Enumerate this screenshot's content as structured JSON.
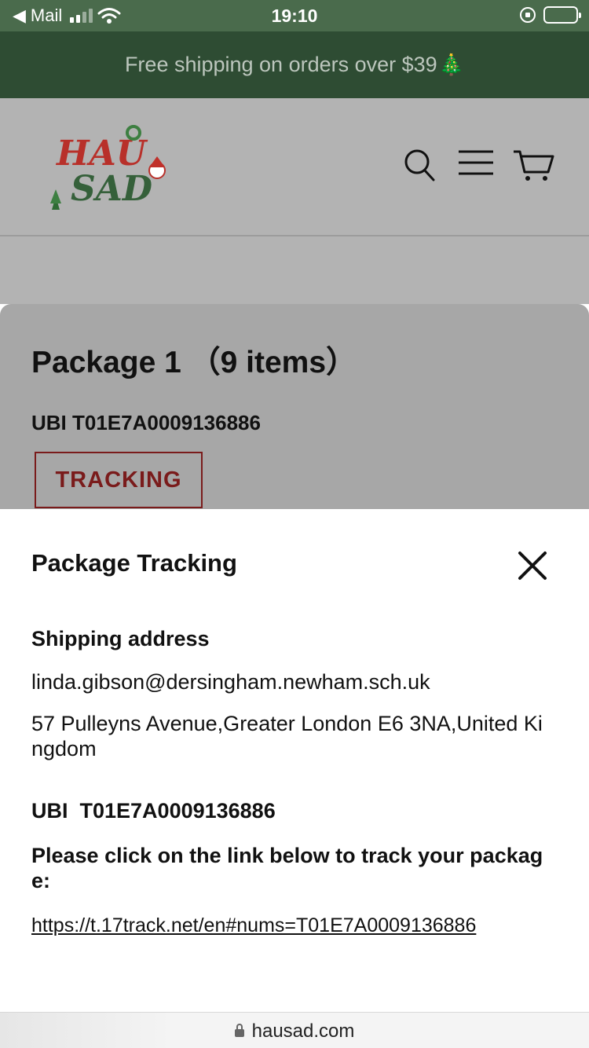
{
  "status_bar": {
    "back_app": "Mail",
    "time": "19:10"
  },
  "announcement": {
    "text": "Free shipping on orders over $39",
    "emoji": "🎄"
  },
  "header": {
    "logo_alt": "HAU SAD",
    "logo_line1": "HAU",
    "logo_line2": "SAD",
    "icons": [
      "search-icon",
      "menu-icon",
      "cart-icon"
    ]
  },
  "package": {
    "title": "Package 1 （9 items）",
    "ubi": "UBI T01E7A0009136886",
    "tracking_label": "TRACKING"
  },
  "tracking_sheet": {
    "title": "Package Tracking",
    "shipping_heading": "Shipping address",
    "email": "linda.gibson@dersingham.newham.sch.uk",
    "address": "57 Pulleyns Avenue,Greater London E6 3NA,United Kingdom",
    "ubi": "UBI  T01E7A0009136886",
    "instruction": "Please click on the link below to track your package:",
    "link": "https://t.17track.net/en#nums=T01E7A0009136886"
  },
  "browser": {
    "url": "hausad.com"
  },
  "colors": {
    "announcement_bg": "#2e4c33",
    "tracking_accent": "#7a1b1b",
    "overlay_gray": "#b3b3b3"
  }
}
